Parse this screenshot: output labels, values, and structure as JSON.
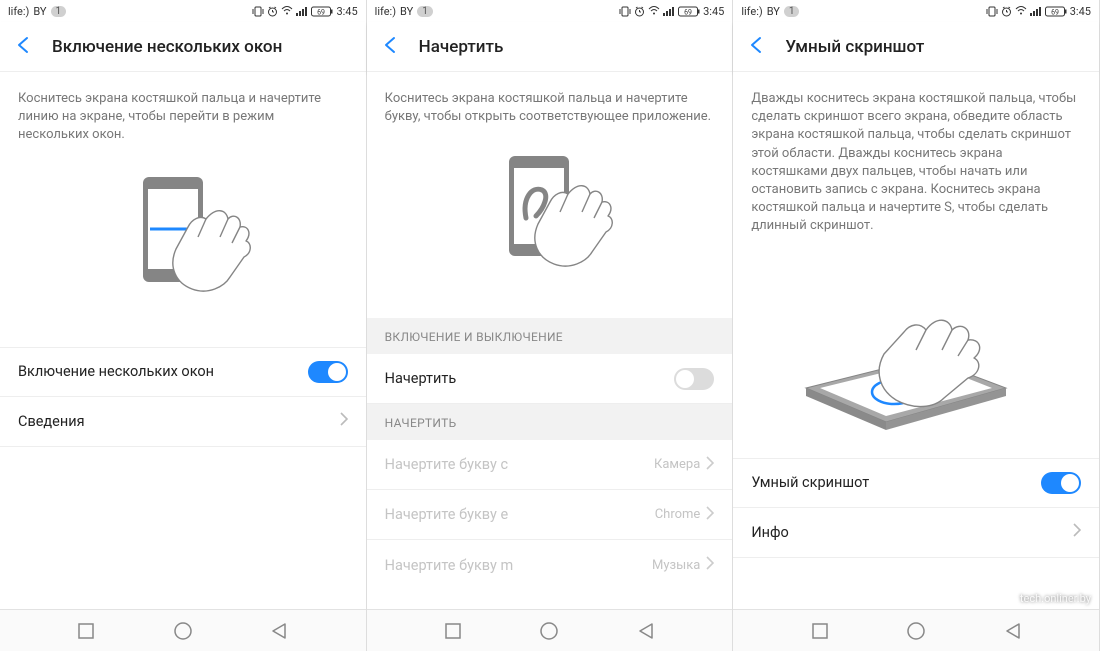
{
  "status": {
    "carrier": "life:)",
    "carrier_sub": "BY",
    "badge": "1",
    "battery": "69",
    "time": "3:45"
  },
  "screen1": {
    "title": "Включение нескольких окон",
    "description": "Коснитесь экрана костяшкой пальца и начертите линию на экране, чтобы перейти в режим нескольких окон.",
    "toggle_label": "Включение нескольких окон",
    "info_label": "Сведения"
  },
  "screen2": {
    "title": "Начертить",
    "description": "Коснитесь экрана костяшкой пальца и начертите букву, чтобы открыть соответствующее приложение.",
    "section_on_off": "ВКЛЮЧЕНИЕ И ВЫКЛЮЧЕНИЕ",
    "toggle_label": "Начертить",
    "section_draw": "НАЧЕРТИТЬ",
    "items": [
      {
        "label": "Начертите букву c",
        "value": "Камера"
      },
      {
        "label": "Начертите букву e",
        "value": "Chrome"
      },
      {
        "label": "Начертите букву m",
        "value": "Музыка"
      }
    ]
  },
  "screen3": {
    "title": "Умный скриншот",
    "description": "Дважды коснитесь экрана костяшкой пальца, чтобы сделать скриншот всего экрана, обведите область экрана костяшкой пальца, чтобы сделать скриншот этой области. Дважды коснитесь экрана костяшками двух пальцев, чтобы начать или остановить запись с экрана. Коснитесь экрана костяшкой пальца и начертите S, чтобы сделать длинный скриншот.",
    "toggle_label": "Умный скриншот",
    "info_label": "Инфо"
  },
  "watermark": "tech.onliner.by"
}
